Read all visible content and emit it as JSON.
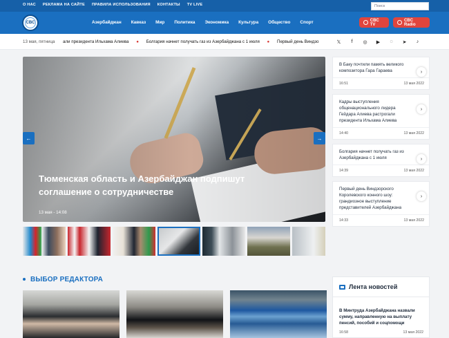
{
  "header": {
    "top_links": [
      "О НАС",
      "РЕКЛАМА НА САЙТЕ",
      "ПРАВИЛА ИСПОЛЬЗОВАНИЯ",
      "КОНТАКТЫ",
      "TV LIVE"
    ],
    "search_placeholder": "Поиск",
    "logo_text": "CBC",
    "menu": [
      "Азербайджан",
      "Кавказ",
      "Мир",
      "Политика",
      "Экономика",
      "Культура",
      "Общество",
      "Спорт"
    ],
    "tv_button": "CBC TV",
    "radio_button": "CBC Radio"
  },
  "ticker": {
    "date": "13 мая, пятница",
    "items": [
      "али президента Ильхама Алиева",
      "Болгария начнет получать газ из Азербайджана с 1 июля",
      "Первый день Виндзо"
    ]
  },
  "social_icons": [
    "twitter-icon",
    "facebook-icon",
    "instagram-icon",
    "youtube-icon",
    "whatsapp-icon",
    "telegram-icon",
    "tiktok-icon"
  ],
  "hero": {
    "title": "Тюменская область и Азербайджан подпишут соглашение о сотрудничестве",
    "time": "13 мая - 14:08",
    "prev": "←",
    "next": "→"
  },
  "thumbnails": [
    "thumb-1",
    "thumb-2",
    "thumb-3",
    "thumb-4",
    "thumb-5",
    "thumb-6",
    "thumb-7"
  ],
  "news": [
    {
      "title": "В Баку почтили память великого композитора Гара Гараева",
      "time": "16:51",
      "date": "13 мая 2022"
    },
    {
      "title": "Кадры выступления общенационального лидера Гейдара Алиева растрогали президента Ильхама Алиева",
      "time": "14:40",
      "date": "13 мая 2022"
    },
    {
      "title": "Болгария начнет получать газ из Азербайджана с 1 июля",
      "time": "14:39",
      "date": "13 мая 2022"
    },
    {
      "title": "Первый день Виндзорского Королевского конного шоу: грандиозное выступление представителей Азербайджана",
      "time": "14:33",
      "date": "13 мая 2022"
    }
  ],
  "editor": {
    "title": "ВЫБОР РЕДАКТОРА"
  },
  "feed": {
    "title": "Лента новостей",
    "item": {
      "title": "В Минтруда Азербайджана назвали сумму, направленную на выплату пенсий, пособий и соцпомощи",
      "time": "16:58",
      "date": "13 мая 2022"
    }
  },
  "colors": {
    "brand_blue": "#1A6FC0",
    "dark_blue": "#1660A8",
    "accent_red": "#E0453D"
  }
}
